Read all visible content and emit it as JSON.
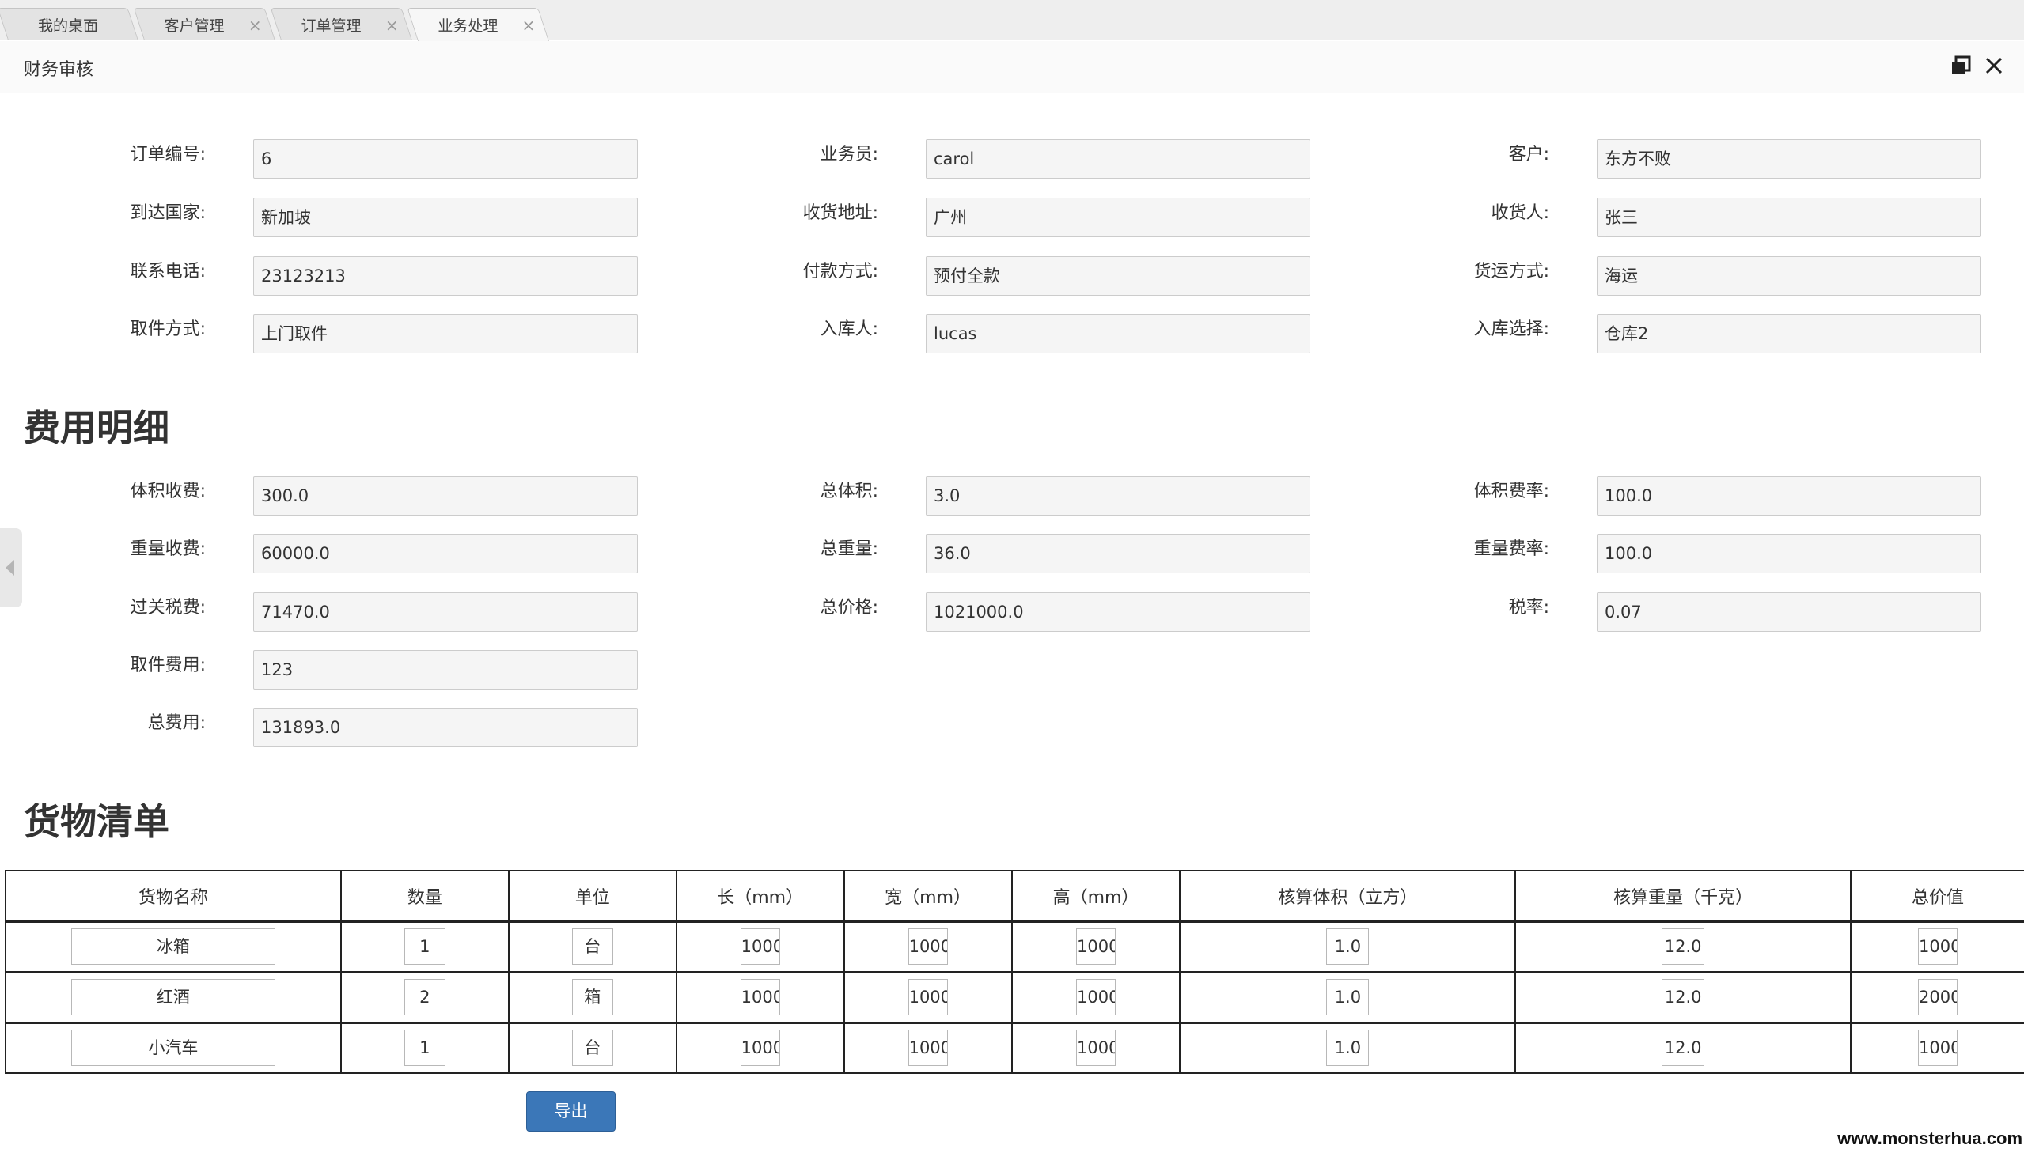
{
  "tabs": [
    {
      "label": "我的桌面",
      "closable": false
    },
    {
      "label": "客户管理",
      "closable": true
    },
    {
      "label": "订单管理",
      "closable": true
    },
    {
      "label": "业务处理",
      "closable": true,
      "active": true
    }
  ],
  "close_glyph": "×",
  "panel": {
    "title": "财务审核"
  },
  "order_info": {
    "order_no": {
      "label": "订单编号:",
      "value": "6"
    },
    "salesman": {
      "label": "业务员:",
      "value": "carol"
    },
    "customer": {
      "label": "客户:",
      "value": "东方不败"
    },
    "country": {
      "label": "到达国家:",
      "value": "新加坡"
    },
    "address": {
      "label": "收货地址:",
      "value": "广州"
    },
    "receiver": {
      "label": "收货人:",
      "value": "张三"
    },
    "phone": {
      "label": "联系电话:",
      "value": "23123213"
    },
    "payment": {
      "label": "付款方式:",
      "value": "预付全款"
    },
    "shipping": {
      "label": "货运方式:",
      "value": "海运"
    },
    "pickup": {
      "label": "取件方式:",
      "value": "上门取件"
    },
    "stocker": {
      "label": "入库人:",
      "value": "lucas"
    },
    "warehouse": {
      "label": "入库选择:",
      "value": "仓库2"
    }
  },
  "fees": {
    "heading": "费用明细",
    "volume_fee": {
      "label": "体积收费:",
      "value": "300.0"
    },
    "total_volume": {
      "label": "总体积:",
      "value": "3.0"
    },
    "volume_rate": {
      "label": "体积费率:",
      "value": "100.0"
    },
    "weight_fee": {
      "label": "重量收费:",
      "value": "60000.0"
    },
    "total_weight": {
      "label": "总重量:",
      "value": "36.0"
    },
    "weight_rate": {
      "label": "重量费率:",
      "value": "100.0"
    },
    "customs_tax": {
      "label": "过关税费:",
      "value": "71470.0"
    },
    "total_price": {
      "label": "总价格:",
      "value": "1021000.0"
    },
    "tax_rate": {
      "label": "税率:",
      "value": "0.07"
    },
    "pickup_fee": {
      "label": "取件费用:",
      "value": "123"
    },
    "total_fee": {
      "label": "总费用:",
      "value": "131893.0"
    }
  },
  "goods": {
    "heading": "货物清单",
    "columns": [
      "货物名称",
      "数量",
      "单位",
      "长（mm）",
      "宽（mm）",
      "高（mm）",
      "核算体积（立方）",
      "核算重量（千克）",
      "总价值"
    ],
    "rows": [
      [
        "冰箱",
        "1",
        "台",
        "1000",
        "1000",
        "1000",
        "1.0",
        "12.0",
        "1000"
      ],
      [
        "红酒",
        "2",
        "箱",
        "1000",
        "1000",
        "1000",
        "1.0",
        "12.0",
        "2000"
      ],
      [
        "小汽车",
        "1",
        "台",
        "1000",
        "1000",
        "1000",
        "1.0",
        "12.0",
        "1000"
      ]
    ]
  },
  "export_label": "导出",
  "watermark": "www.monsterhua.com",
  "colors": {
    "primary_button": "#3b77b8",
    "input_bg": "#f5f5f5"
  },
  "icons": [
    "restore-window-icon",
    "close-icon",
    "collapse-left-arrow-icon"
  ]
}
